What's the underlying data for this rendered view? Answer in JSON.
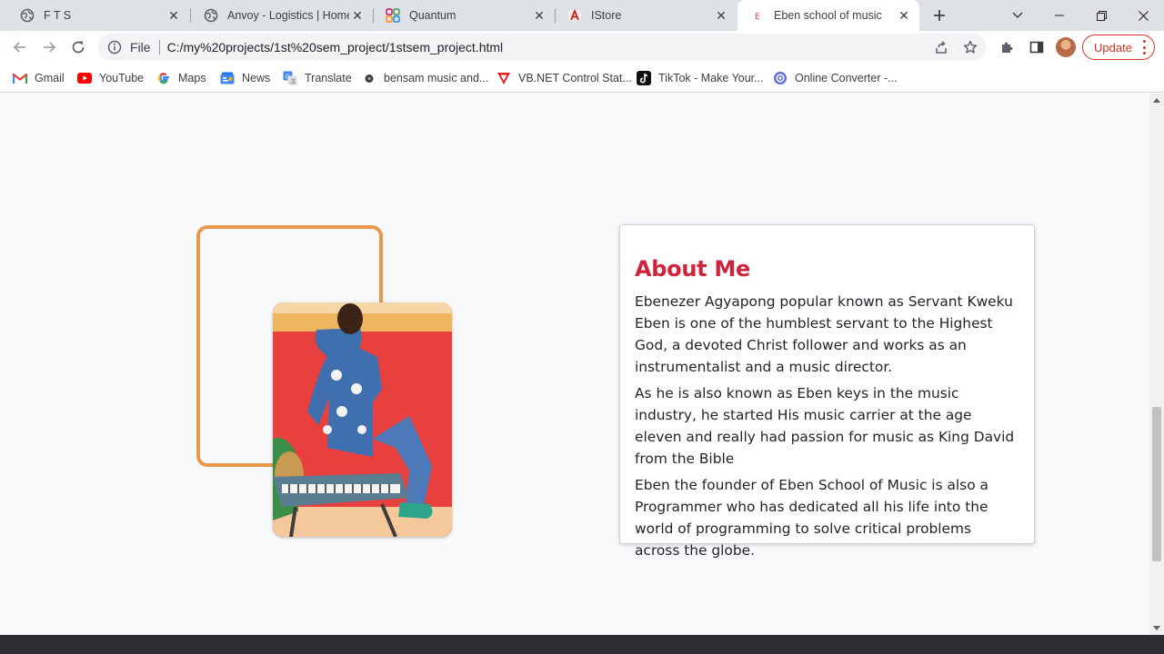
{
  "browser": {
    "tabs": [
      {
        "title": "F T S",
        "icon": "globe-icon"
      },
      {
        "title": "Anvoy - Logistics | Home",
        "icon": "globe-icon"
      },
      {
        "title": "Quantum",
        "icon": "quantum-logo-icon"
      },
      {
        "title": "IStore",
        "icon": "istore-logo-icon"
      },
      {
        "title": "Eben school of music",
        "icon": "eben-favicon-icon",
        "active": true
      }
    ],
    "address": {
      "scheme": "File",
      "url": "C:/my%20projects/1st%20sem_project/1stsem_project.html"
    },
    "update_label": "Update",
    "bookmarks": [
      {
        "label": "Gmail",
        "icon": "gmail-icon"
      },
      {
        "label": "YouTube",
        "icon": "youtube-icon"
      },
      {
        "label": "Maps",
        "icon": "google-maps-icon"
      },
      {
        "label": "News",
        "icon": "google-news-icon"
      },
      {
        "label": "Translate",
        "icon": "google-translate-icon"
      },
      {
        "label": "bensam music and...",
        "icon": "bensam-music-icon"
      },
      {
        "label": "VB.NET Control Stat...",
        "icon": "vbnet-icon"
      },
      {
        "label": "TikTok - Make Your...",
        "icon": "tiktok-icon"
      },
      {
        "label": "Online Converter -...",
        "icon": "online-converter-icon"
      }
    ]
  },
  "page": {
    "about": {
      "title": "About Me",
      "paragraphs": [
        "Ebenezer Agyapong popular known as Servant Kweku Eben is one of the humblest servant to the Highest God, a devoted Christ follower and works as an instrumentalist and a music director.",
        "As he is also known as Eben keys in the music industry, he started His music carrier at the age eleven and really had passion for music as King David from the Bible",
        "Eben the founder of Eben School of Music is also a Programmer who has dedicated all his life into the world of programming to solve critical problems across the globe."
      ]
    },
    "photo_icon": "portrait-keyboardist-photo"
  },
  "colors": {
    "accent_title": "#d0243c",
    "frame_orange": "#e8994b",
    "update_red": "#d93025",
    "footer": "#2b2d31"
  }
}
